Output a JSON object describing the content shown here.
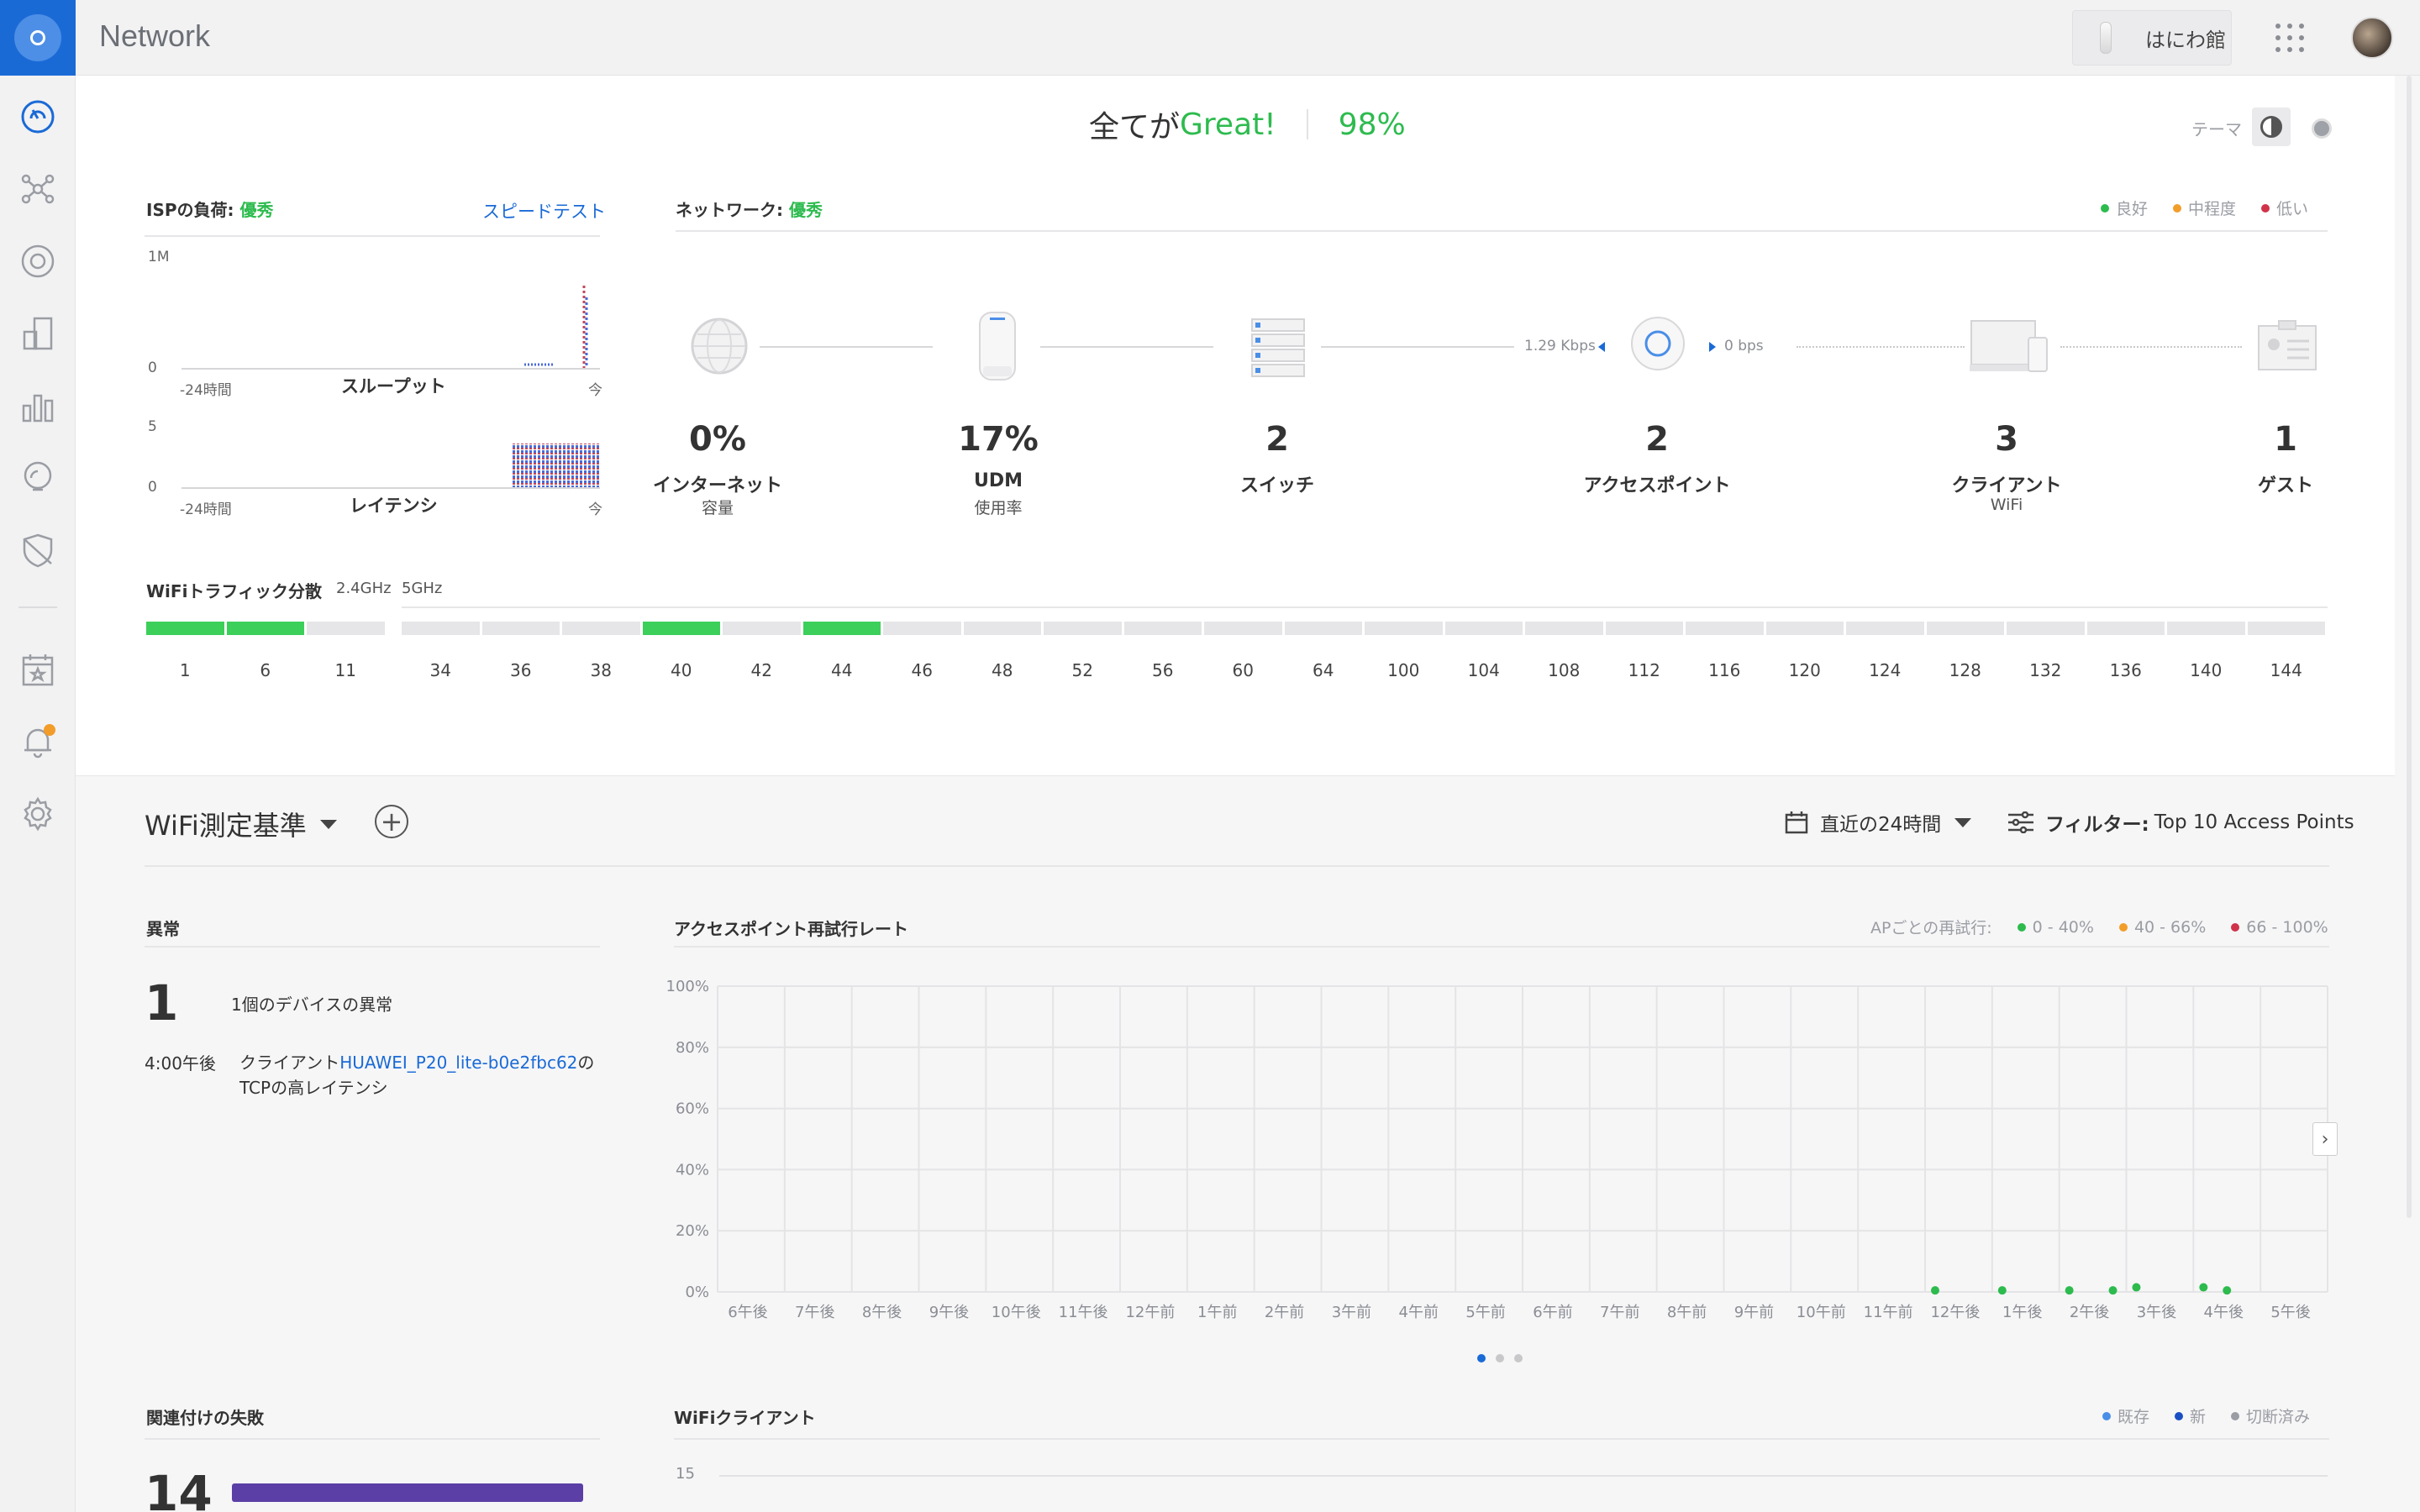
{
  "app": {
    "title": "Network"
  },
  "header": {
    "site_name": "はにわ館"
  },
  "sidebar": {
    "items": [
      {
        "icon": "dashboard-icon"
      },
      {
        "icon": "topology-icon"
      },
      {
        "icon": "devices-icon"
      },
      {
        "icon": "clients-icon"
      },
      {
        "icon": "statistics-icon"
      },
      {
        "icon": "insights-icon"
      },
      {
        "icon": "shield-icon"
      },
      {
        "icon": "events-icon"
      },
      {
        "icon": "alarms-icon"
      },
      {
        "icon": "settings-icon"
      }
    ]
  },
  "summary": {
    "prefix": "全てが",
    "status": "Great!",
    "score": "98%"
  },
  "theme": {
    "label": "テーマ"
  },
  "isp": {
    "title_prefix": "ISPの負荷: ",
    "title_status": "優秀",
    "speedtest_label": "スピードテスト",
    "throughput": {
      "caption": "スループット",
      "y_max": "1M",
      "y_min": "0",
      "x_start": "-24時間",
      "x_end": "今"
    },
    "latency": {
      "caption": "レイテンシ",
      "y_max": "5",
      "y_min": "0",
      "x_start": "-24時間",
      "x_end": "今"
    }
  },
  "network": {
    "title_prefix": "ネットワーク: ",
    "title_status": "優秀",
    "legend": [
      {
        "label": "良好",
        "color": "#2dbb4e"
      },
      {
        "label": "中程度",
        "color": "#f29d2a"
      },
      {
        "label": "低い",
        "color": "#d0334a"
      }
    ],
    "rate_down": "1.29 Kbps",
    "rate_up": "0 bps",
    "nodes": [
      {
        "value": "0%",
        "label": "インターネット",
        "sub": "容量"
      },
      {
        "value": "17%",
        "label": "UDM",
        "sub": "使用率"
      },
      {
        "value": "2",
        "label": "スイッチ",
        "sub": ""
      },
      {
        "value": "2",
        "label": "アクセスポイント",
        "sub": ""
      },
      {
        "value": "3",
        "label": "クライアント",
        "sub": "WiFi"
      },
      {
        "value": "1",
        "label": "ゲスト",
        "sub": ""
      }
    ]
  },
  "wifi_dist": {
    "title": "WiFiトラフィック分散",
    "band_24": "2.4GHz",
    "band_5": "5GHz",
    "channels_24": [
      {
        "ch": "1",
        "active": true
      },
      {
        "ch": "6",
        "active": true
      },
      {
        "ch": "11",
        "active": false
      }
    ],
    "channels_5": [
      {
        "ch": "34",
        "active": false
      },
      {
        "ch": "36",
        "active": false
      },
      {
        "ch": "38",
        "active": false
      },
      {
        "ch": "40",
        "active": true
      },
      {
        "ch": "42",
        "active": false
      },
      {
        "ch": "44",
        "active": true
      },
      {
        "ch": "46",
        "active": false
      },
      {
        "ch": "48",
        "active": false
      },
      {
        "ch": "52",
        "active": false
      },
      {
        "ch": "56",
        "active": false
      },
      {
        "ch": "60",
        "active": false
      },
      {
        "ch": "64",
        "active": false
      },
      {
        "ch": "100",
        "active": false
      },
      {
        "ch": "104",
        "active": false
      },
      {
        "ch": "108",
        "active": false
      },
      {
        "ch": "112",
        "active": false
      },
      {
        "ch": "116",
        "active": false
      },
      {
        "ch": "120",
        "active": false
      },
      {
        "ch": "124",
        "active": false
      },
      {
        "ch": "128",
        "active": false
      },
      {
        "ch": "132",
        "active": false
      },
      {
        "ch": "136",
        "active": false
      },
      {
        "ch": "140",
        "active": false
      },
      {
        "ch": "144",
        "active": false
      }
    ]
  },
  "metrics": {
    "title": "WiFi測定基準",
    "time_range": "直近の24時間",
    "filter_label": "フィルター:",
    "filter_value": "Top 10 Access Points"
  },
  "anomalies": {
    "title": "異常",
    "count": "1",
    "summary": "1個のデバイスの異常",
    "time": "4:00午後",
    "text_prefix": "クライアント",
    "device_link": "HUAWEI_P20_lite-b0e2fbc62",
    "text_suffix": "のTCPの高レイテンシ"
  },
  "retry": {
    "title": "アクセスポイント再試行レート",
    "legend_prefix": "APごとの再試行:",
    "legend": [
      {
        "label": "0 - 40%",
        "color": "#2dbb4e"
      },
      {
        "label": "40 - 66%",
        "color": "#f29d2a"
      },
      {
        "label": "66 - 100%",
        "color": "#d0334a"
      }
    ]
  },
  "chart_data": {
    "type": "scatter",
    "title": "アクセスポイント再試行レート",
    "xlabel": "",
    "ylabel": "",
    "categories": [
      "6午後",
      "7午後",
      "8午後",
      "9午後",
      "10午後",
      "11午後",
      "12午前",
      "1午前",
      "2午前",
      "3午前",
      "4午前",
      "5午前",
      "6午前",
      "7午前",
      "8午前",
      "9午前",
      "10午前",
      "11午前",
      "12午後",
      "1午後",
      "2午後",
      "3午後",
      "4午後",
      "5午後"
    ],
    "y_ticks": [
      "0%",
      "20%",
      "40%",
      "60%",
      "80%",
      "100%"
    ],
    "ylim": [
      0,
      100
    ],
    "grid": true,
    "series": [
      {
        "color": "#2dbb4e",
        "points": [
          {
            "x": 18.15,
            "y": 0.5
          },
          {
            "x": 19.15,
            "y": 0.5
          },
          {
            "x": 20.15,
            "y": 0.5
          },
          {
            "x": 20.8,
            "y": 0.5
          },
          {
            "x": 21.15,
            "y": 1.5
          },
          {
            "x": 22.15,
            "y": 1.5
          },
          {
            "x": 22.5,
            "y": 0.5
          }
        ]
      }
    ]
  },
  "assoc": {
    "title": "関連付けの失敗",
    "count": "14"
  },
  "wifi_clients": {
    "title": "WiFiクライアント",
    "y_top": "15",
    "legend": [
      {
        "label": "既存",
        "color": "#4a8ee8"
      },
      {
        "label": "新",
        "color": "#1a4fc4"
      },
      {
        "label": "切断済み",
        "color": "#9a9da3"
      }
    ]
  }
}
